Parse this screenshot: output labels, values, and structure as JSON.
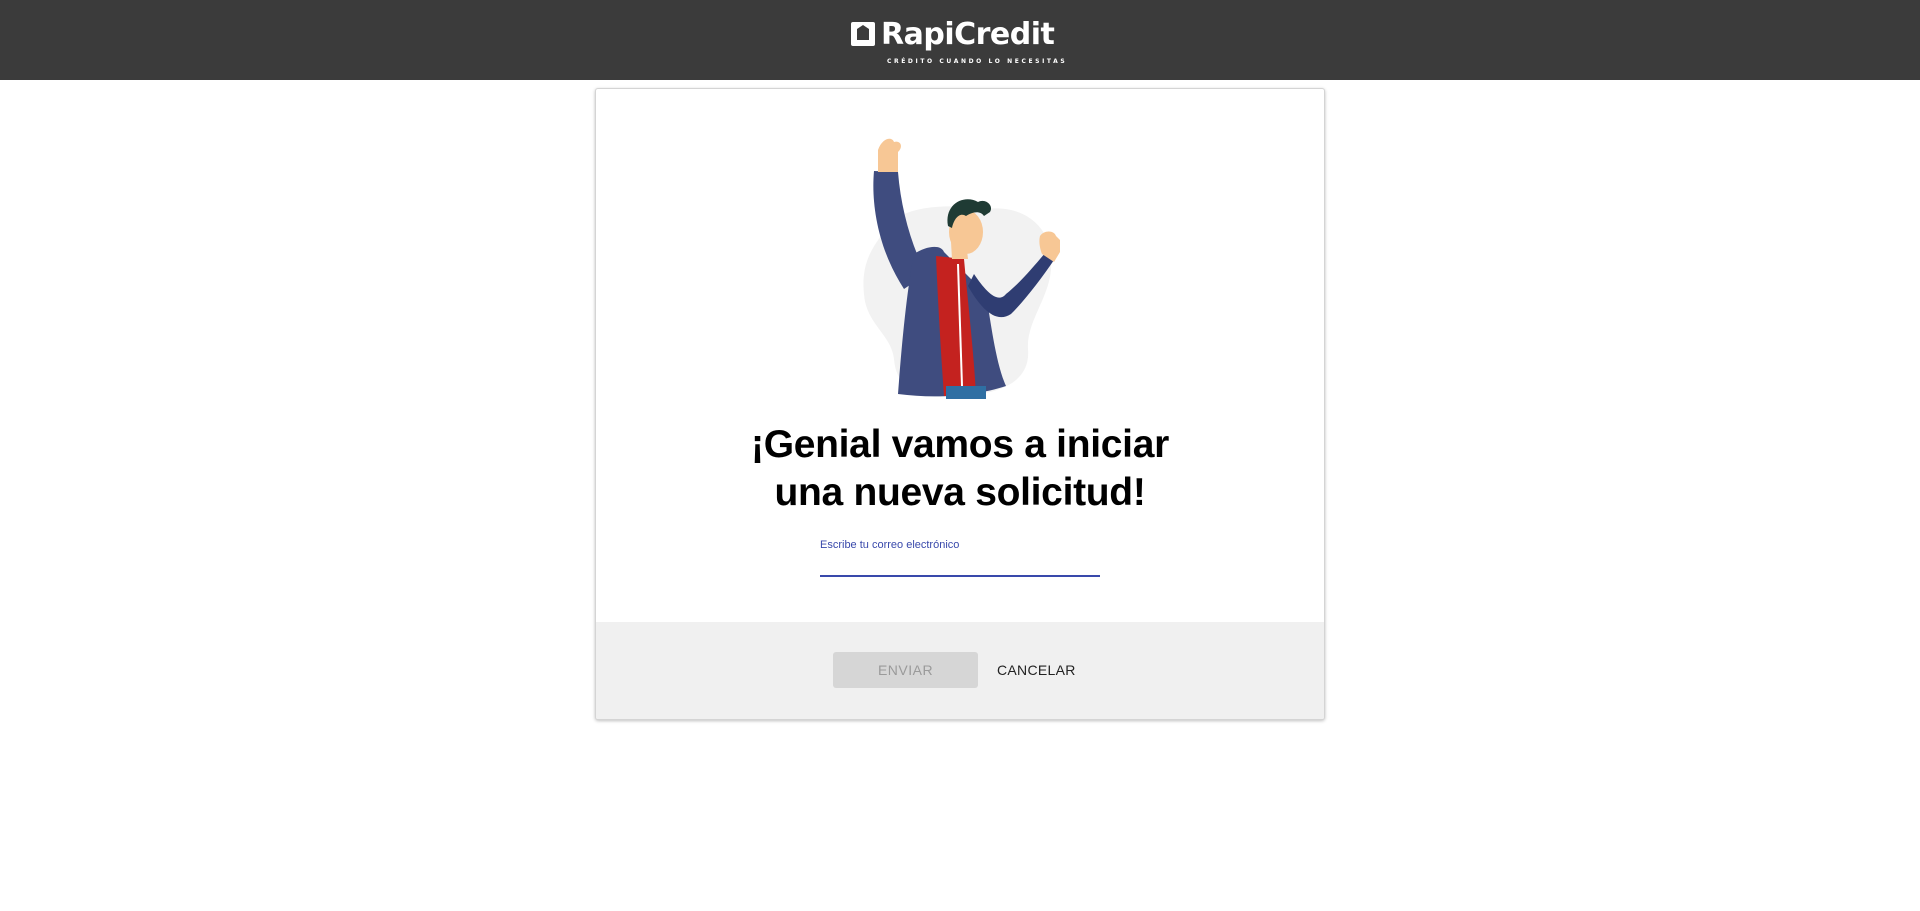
{
  "header": {
    "brand_name": "RapiCredit",
    "tagline": "CRÉDITO CUANDO LO NECESITAS",
    "logo_icon": "rapicredit-logo-icon",
    "background": "#3b3b3b"
  },
  "card": {
    "illustration": "celebrating-man-illustration",
    "headline_line1": "¡Genial vamos a iniciar",
    "headline_line2": "una nueva solicitud!",
    "email_field": {
      "label": "Escribe tu correo electrónico",
      "value": "",
      "accent_color": "#3949ab"
    }
  },
  "actions": {
    "send_label": "ENVIAR",
    "send_disabled": true,
    "cancel_label": "CANCELAR"
  }
}
